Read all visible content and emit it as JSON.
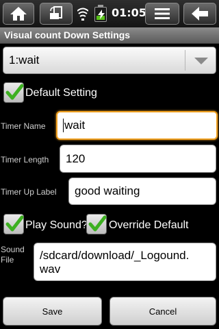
{
  "status_bar": {
    "clock": "01:05",
    "icons": [
      "home-icon",
      "screen-rotate-icon",
      "wifi-icon",
      "battery-charging-icon",
      "menu-icon",
      "back-arrow-icon"
    ],
    "battery_level": 0.3,
    "colors": {
      "battery": "#5ac31a"
    }
  },
  "title_bar": {
    "title": "Visual count Down Settings"
  },
  "profile_spinner": {
    "selected": "1:wait"
  },
  "default_setting": {
    "label": "Default Setting",
    "checked": true
  },
  "form": {
    "timer_name": {
      "label": "Timer Name",
      "value": "wait"
    },
    "timer_length": {
      "label": "Timer Length",
      "value": "120"
    },
    "timer_up_label": {
      "label": "Timer Up Label",
      "value": "good waiting"
    },
    "sound_file": {
      "label_line1": "Sound",
      "label_line2": "File",
      "value_line1": "/sdcard/download/_Logound.",
      "value_line2": "wav"
    }
  },
  "play_sound": {
    "label": "Play Sound?",
    "checked": true
  },
  "override_default": {
    "label": "Override Default",
    "checked": true
  },
  "buttons": {
    "save": "Save",
    "cancel": "Cancel"
  },
  "colors": {
    "focus_accent": "#f0a020",
    "checkmark": "#3db021"
  }
}
